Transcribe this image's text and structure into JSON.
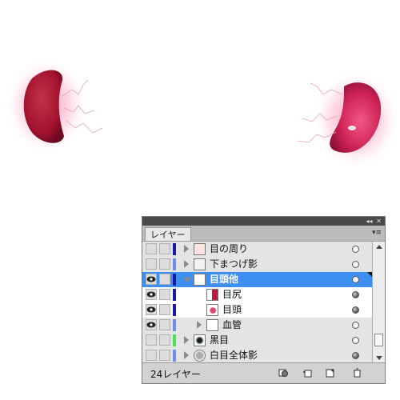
{
  "colors": {
    "selection": "#3d8ff2",
    "orb_fill": "#c2173f",
    "orb_glow": "#ff4d8d"
  },
  "panel": {
    "title": "レイヤー",
    "title_buttons": [
      "◂◂",
      "✕"
    ],
    "menu_icon": "▾≡",
    "layers": [
      {
        "name": "目の周り",
        "visible": false,
        "color": "#1a1aa8",
        "indent": 0,
        "expanded": false,
        "thumbnail": "pink-thumb-icon",
        "selected": false
      },
      {
        "name": "下まつげ影",
        "visible": false,
        "color": "#6e8fe6",
        "indent": 0,
        "expanded": false,
        "thumbnail": "sketch-thumb-icon",
        "selected": false
      },
      {
        "name": "目頭他",
        "visible": true,
        "color": "#1a1aa8",
        "indent": 0,
        "expanded": true,
        "thumbnail": "dots-thumb-icon",
        "selected": true
      },
      {
        "name": "目尻",
        "visible": true,
        "color": "#1a1aa8",
        "indent": 1,
        "expanded": null,
        "thumbnail": "half-moon-thumb-icon",
        "selected": false
      },
      {
        "name": "目頭",
        "visible": true,
        "color": "#1a1aa8",
        "indent": 1,
        "expanded": null,
        "thumbnail": "drop-thumb-icon",
        "selected": false
      },
      {
        "name": "血管",
        "visible": true,
        "color": "#6e8fe6",
        "indent": 1,
        "expanded": false,
        "thumbnail": "blank-thumb-icon",
        "selected": false
      },
      {
        "name": "黒目",
        "visible": false,
        "color": "#52e052",
        "indent": 0,
        "expanded": false,
        "thumbnail": "iris-thumb-icon",
        "selected": false
      },
      {
        "name": "白目全体影",
        "visible": false,
        "color": "#6e8fe6",
        "indent": 0,
        "expanded": false,
        "thumbnail": "circle-thumb-icon",
        "selected": false
      }
    ],
    "layer_count": "24レイヤー",
    "footer_buttons": [
      "make-clipping-mask-icon",
      "new-sublayer-icon",
      "new-layer-icon",
      "delete-layer-icon"
    ]
  }
}
